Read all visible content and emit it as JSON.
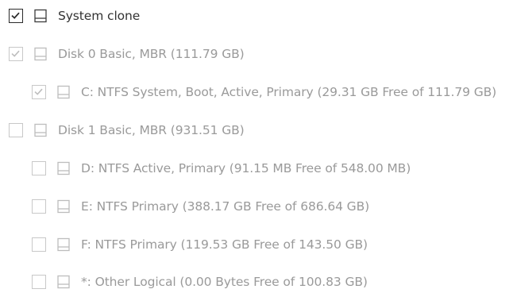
{
  "tree": {
    "root": {
      "label": "System clone",
      "checked": true,
      "icon": "hard-drive-icon"
    },
    "disk0": {
      "label": "Disk 0 Basic, MBR (111.79 GB)",
      "checked": true,
      "disabled": true,
      "icon": "hard-drive-icon"
    },
    "partitionC": {
      "label": "C: NTFS System, Boot, Active, Primary (29.31 GB Free of 111.79 GB)",
      "checked": true,
      "disabled": true,
      "icon": "hard-drive-icon"
    },
    "disk1": {
      "label": "Disk 1 Basic, MBR (931.51 GB)",
      "checked": false,
      "icon": "hard-drive-icon"
    },
    "partitionD": {
      "label": "D: NTFS Active, Primary (91.15 MB Free of 548.00 MB)",
      "checked": false,
      "icon": "hard-drive-icon"
    },
    "partitionE": {
      "label": "E: NTFS Primary (388.17 GB Free of 686.64 GB)",
      "checked": false,
      "icon": "hard-drive-icon"
    },
    "partitionF": {
      "label": "F: NTFS Primary (119.53 GB Free of 143.50 GB)",
      "checked": false,
      "icon": "hard-drive-icon"
    },
    "partitionOther": {
      "label": "*: Other Logical (0.00 Bytes Free of 100.83 GB)",
      "checked": false,
      "icon": "hard-drive-icon"
    }
  },
  "colors": {
    "text_active": "#333333",
    "text_inactive": "#9a9a9a",
    "checkbox_border_active": "#2b2b2b",
    "checkbox_border_inactive": "#c8c8c8"
  }
}
